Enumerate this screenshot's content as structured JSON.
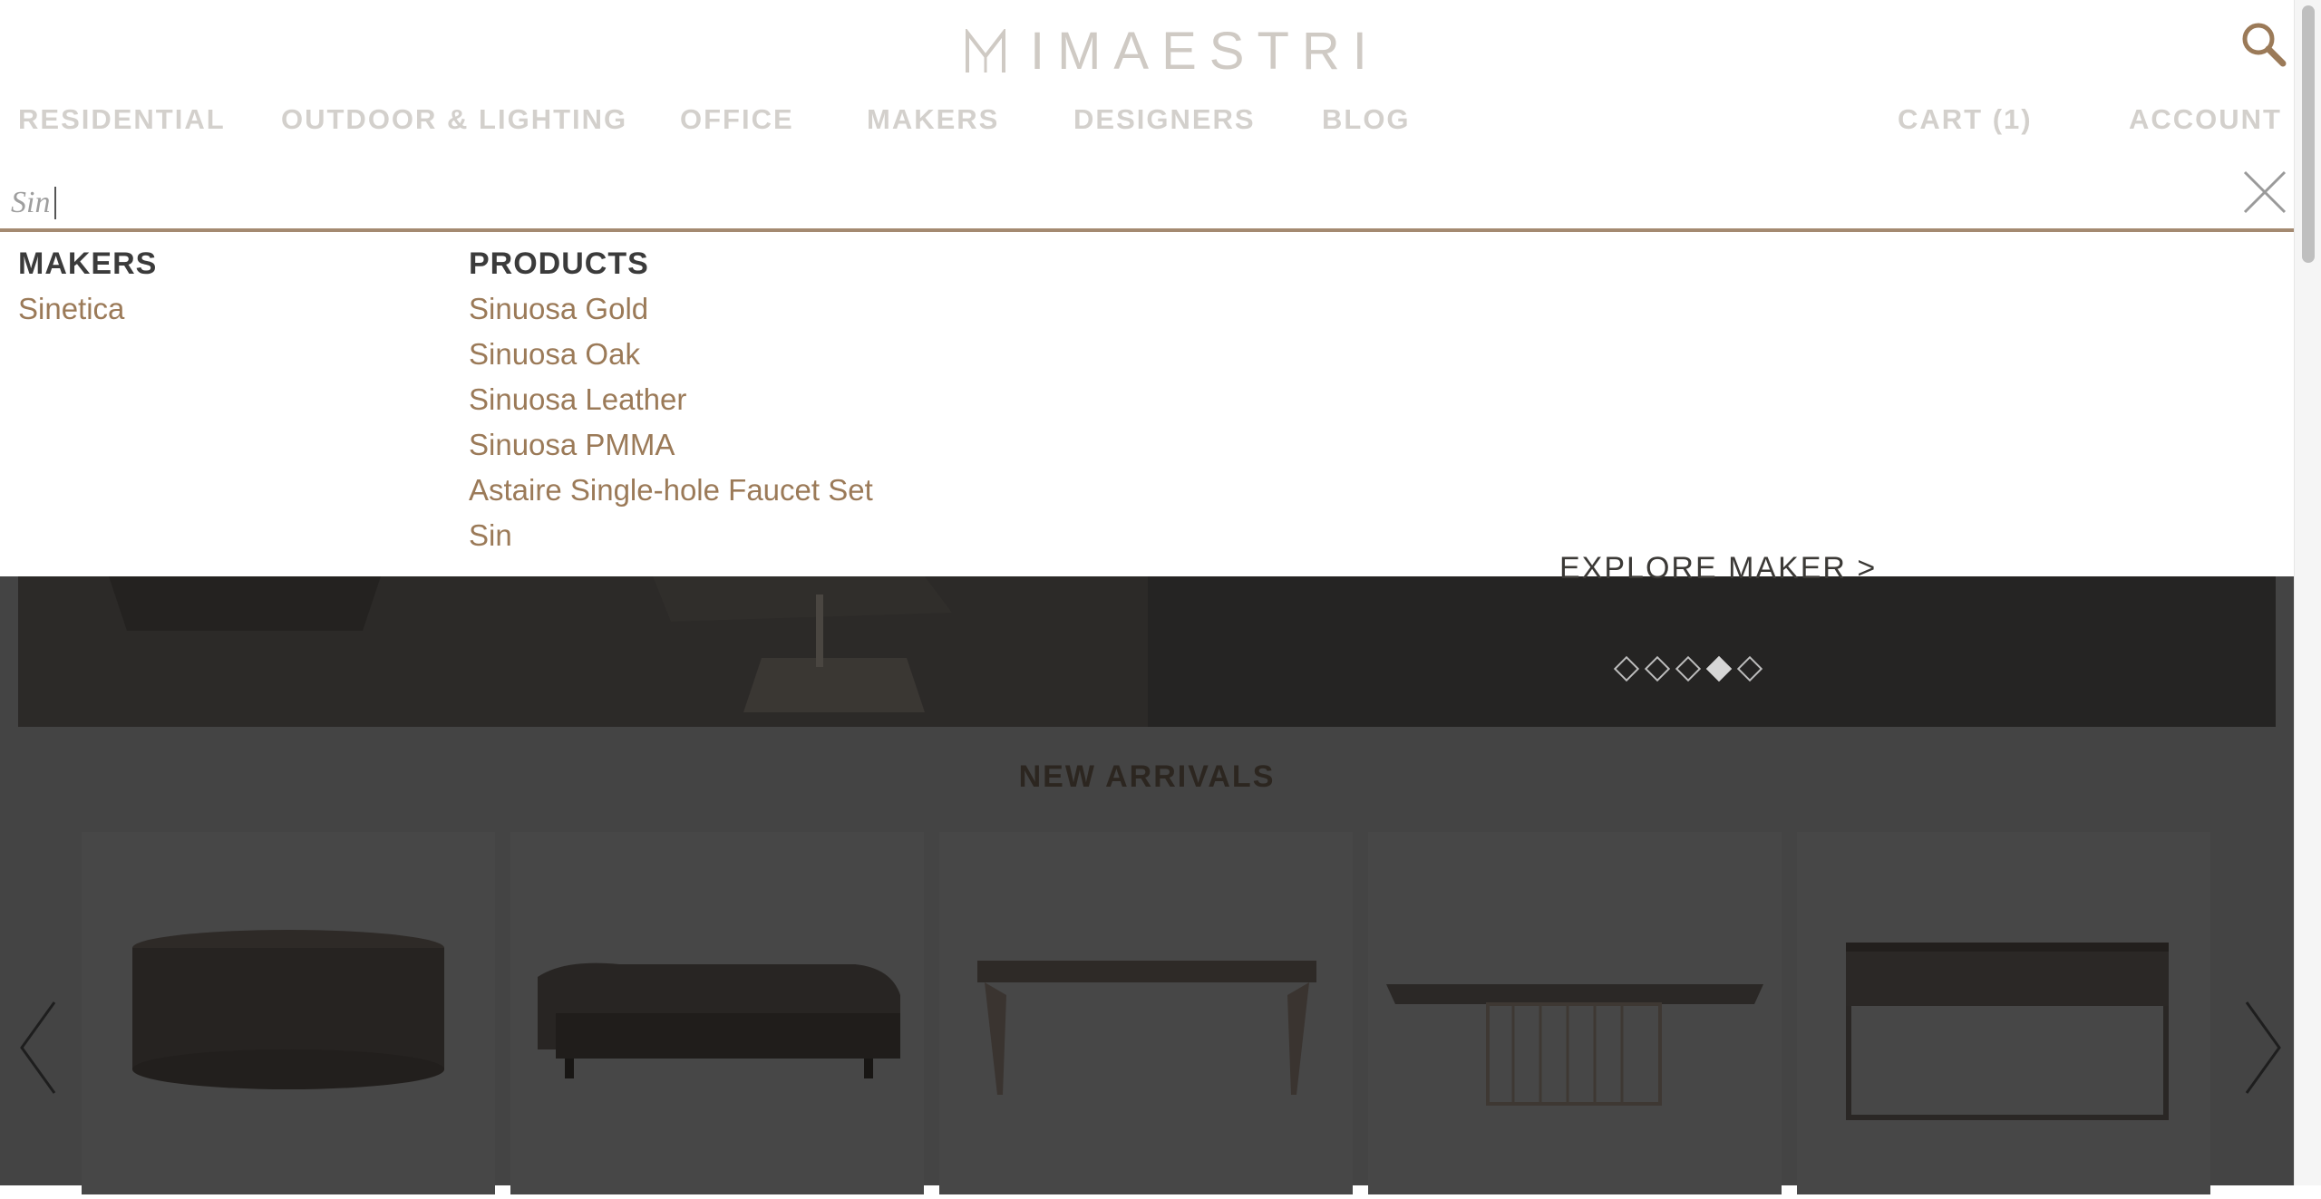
{
  "brand": {
    "name": "IMAESTRI",
    "accent": "#a48a71",
    "link_color": "#9b7a58"
  },
  "icons": {
    "search": "search-icon",
    "close": "close-icon",
    "logo": "maestri-logo-mark",
    "prev": "chevron-left-icon",
    "next": "chevron-right-icon"
  },
  "nav": {
    "residential": "RESIDENTIAL",
    "outdoor_lighting": "OUTDOOR & LIGHTING",
    "office": "OFFICE",
    "makers": "MAKERS",
    "designers": "DESIGNERS",
    "blog": "BLOG",
    "cart": "CART (1)",
    "account": "ACCOUNT"
  },
  "search": {
    "value": "Sin"
  },
  "results": {
    "makers_heading": "MAKERS",
    "makers": [
      "Sinetica"
    ],
    "products_heading": "PRODUCTS",
    "products": [
      "Sinuosa Gold",
      "Sinuosa Oak",
      "Sinuosa Leather",
      "Sinuosa PMMA",
      "Astaire Single-hole Faucet Set",
      "Sin"
    ]
  },
  "hero": {
    "cta": "EXPLORE MAKER >",
    "slide_count": 5,
    "active_slide": 4
  },
  "new_arrivals": {
    "title": "NEW ARRIVALS",
    "items": [
      "round-cabinet",
      "sofa",
      "dining-table",
      "marble-dining-table",
      "console-table"
    ]
  }
}
